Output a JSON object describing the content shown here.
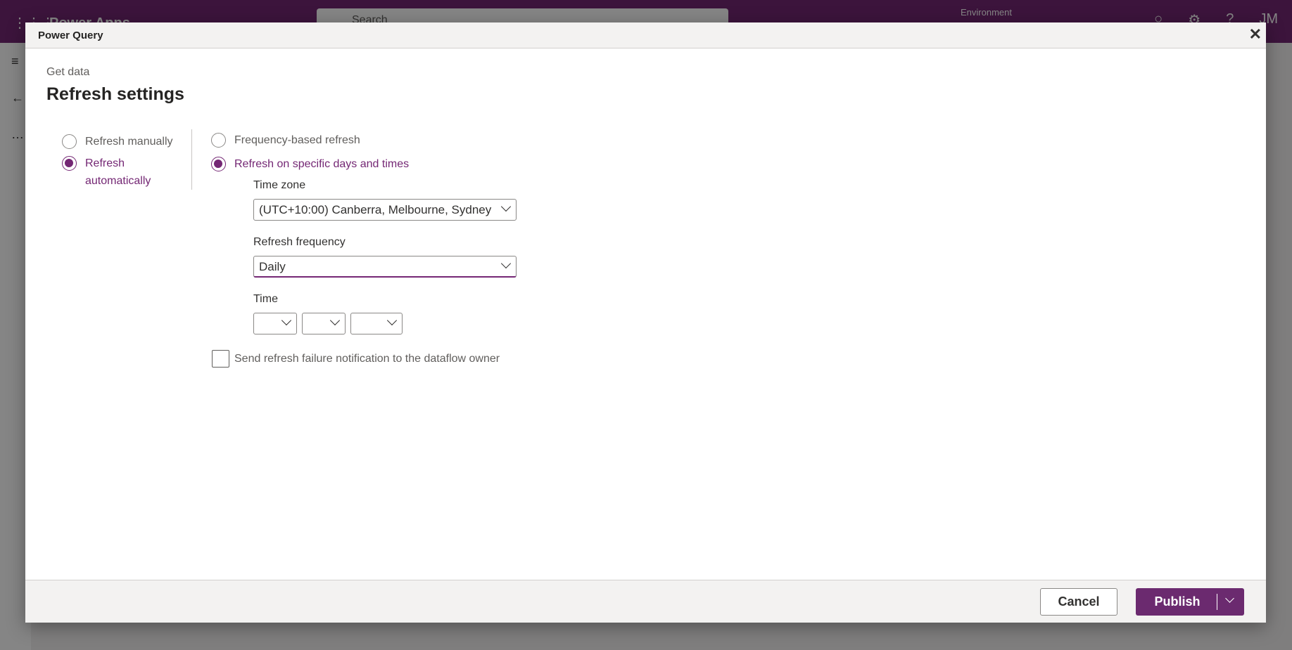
{
  "app": {
    "name": "Power Apps",
    "search_placeholder": "Search",
    "environment_label": "Environment",
    "avatar": "JM"
  },
  "dialog": {
    "title": "Power Query",
    "breadcrumb": "Get data",
    "heading": "Refresh settings",
    "mode_options": [
      {
        "label": "Refresh manually",
        "selected": false
      },
      {
        "label": "Refresh automatically",
        "selected": true
      }
    ],
    "type_options": [
      {
        "label": "Frequency-based refresh",
        "selected": false
      },
      {
        "label": "Refresh on specific days and times",
        "selected": true
      }
    ],
    "time_zone": {
      "label": "Time zone",
      "value": "(UTC+10:00) Canberra, Melbourne, Sydney"
    },
    "frequency": {
      "label": "Refresh frequency",
      "value": "Daily"
    },
    "time": {
      "label": "Time",
      "hour": "",
      "minute": "",
      "ampm": ""
    },
    "notify": {
      "label": "Send refresh failure notification to the dataflow owner",
      "checked": false
    },
    "cancel": "Cancel",
    "publish": "Publish"
  },
  "colors": {
    "accent": "#742774"
  }
}
